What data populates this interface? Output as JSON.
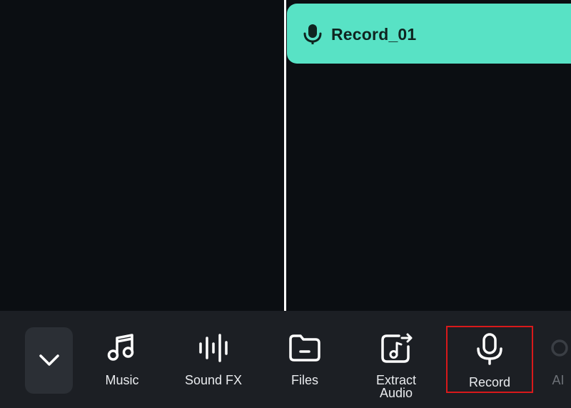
{
  "timeline": {
    "clip": {
      "label": "Record_01",
      "icon": "microphone-icon",
      "color": "#58e2c5"
    }
  },
  "toolbar": {
    "collapse_icon": "chevron-down-icon",
    "items": [
      {
        "label": "Music",
        "icon": "music-note-icon"
      },
      {
        "label": "Sound FX",
        "icon": "sound-wave-icon"
      },
      {
        "label": "Files",
        "icon": "folder-icon"
      },
      {
        "label": "Extract\nAudio",
        "icon": "extract-audio-icon"
      },
      {
        "label": "Record",
        "icon": "microphone-icon",
        "highlighted": true,
        "highlight_color": "#d9191b"
      },
      {
        "label": "AI",
        "icon": "ai-icon"
      }
    ]
  }
}
